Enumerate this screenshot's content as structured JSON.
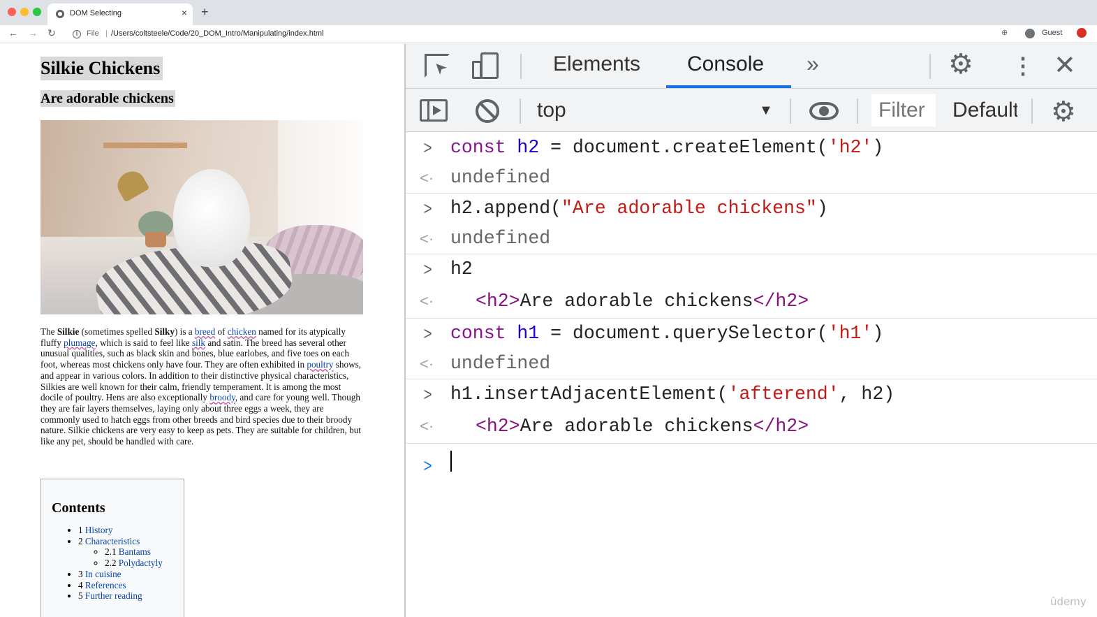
{
  "browser": {
    "tab_title": "DOM Selecting",
    "tab_close": "×",
    "new_tab": "+",
    "nav": {
      "back": "←",
      "forward": "→",
      "reload": "↻"
    },
    "url_scheme_label": "File",
    "url_separator": "|",
    "url": "/Users/coltsteele/Code/20_DOM_Intro/Manipulating/index.html",
    "profile_label": "Guest",
    "zoom_icon": "⊕"
  },
  "page": {
    "h1": "Silkie Chickens",
    "h2": "Are adorable chickens",
    "paragraph": {
      "p1": "The ",
      "b1": "Silkie",
      "p2": " (sometimes spelled ",
      "b2": "Silky",
      "p3": ") is a ",
      "l_breed": "breed",
      "p4": " of ",
      "l_chicken": "chicken",
      "p5": " named for its atypically fluffy ",
      "l_plumage": "plumage",
      "p6": ", which is said to feel like ",
      "l_silk": "silk",
      "p7": " and satin. The breed has several other unusual qualities, such as black skin and bones, blue earlobes, and five toes on each foot, whereas most chickens only have four. They are often exhibited in ",
      "l_poultry": "poultry",
      "p8": " shows, and appear in various colors. In addition to their distinctive physical characteristics, Silkies are well known for their calm, friendly temperament. It is among the most docile of poultry. Hens are also exceptionally ",
      "l_broody": "broody",
      "p9": ", and care for young well. Though they are fair layers themselves, laying only about three eggs a week, they are commonly used to hatch eggs from other breeds and bird species due to their broody nature. Silkie chickens are very easy to keep as pets. They are suitable for children, but like any pet, should be handled with care."
    },
    "toc": {
      "title": "Contents",
      "items": [
        {
          "num": "1 ",
          "label": "History"
        },
        {
          "num": "2 ",
          "label": "Characteristics"
        },
        {
          "num": "2.1 ",
          "label": "Bantams"
        },
        {
          "num": "2.2 ",
          "label": "Polydactyly"
        },
        {
          "num": "3 ",
          "label": "In cuisine"
        },
        {
          "num": "4 ",
          "label": "References"
        },
        {
          "num": "5 ",
          "label": "Further reading"
        }
      ]
    }
  },
  "devtools": {
    "tabs": {
      "elements": "Elements",
      "console": "Console",
      "more": "»"
    },
    "context": "top",
    "context_arrow": "▼",
    "filter_placeholder": "Filter",
    "levels": "Default levels",
    "icons": {
      "settings": "⚙",
      "kebab": "⋮",
      "close": "✕"
    },
    "console": {
      "prompt": ">",
      "return": "<·",
      "undefined": "undefined",
      "entries": [
        {
          "kw": "const",
          "var": "h2",
          "op": " = ",
          "call": "document.createElement(",
          "str": "'h2'",
          "end": ")"
        },
        {
          "pre": "h2.append(",
          "str": "\"Are adorable chickens\"",
          "end": ")"
        },
        {
          "pre": "h2"
        },
        {
          "kw": "const",
          "var": "h1",
          "op": " = ",
          "call": "document.querySelector(",
          "str": "'h1'",
          "end": ")"
        },
        {
          "pre": "h1.insertAdjacentElement(",
          "str": "'afterend'",
          "end": ", h2)"
        }
      ],
      "element_output": {
        "open": "<h2>",
        "text": "Are adorable chickens",
        "close": "</h2>"
      }
    }
  },
  "watermark": "ûdemy"
}
